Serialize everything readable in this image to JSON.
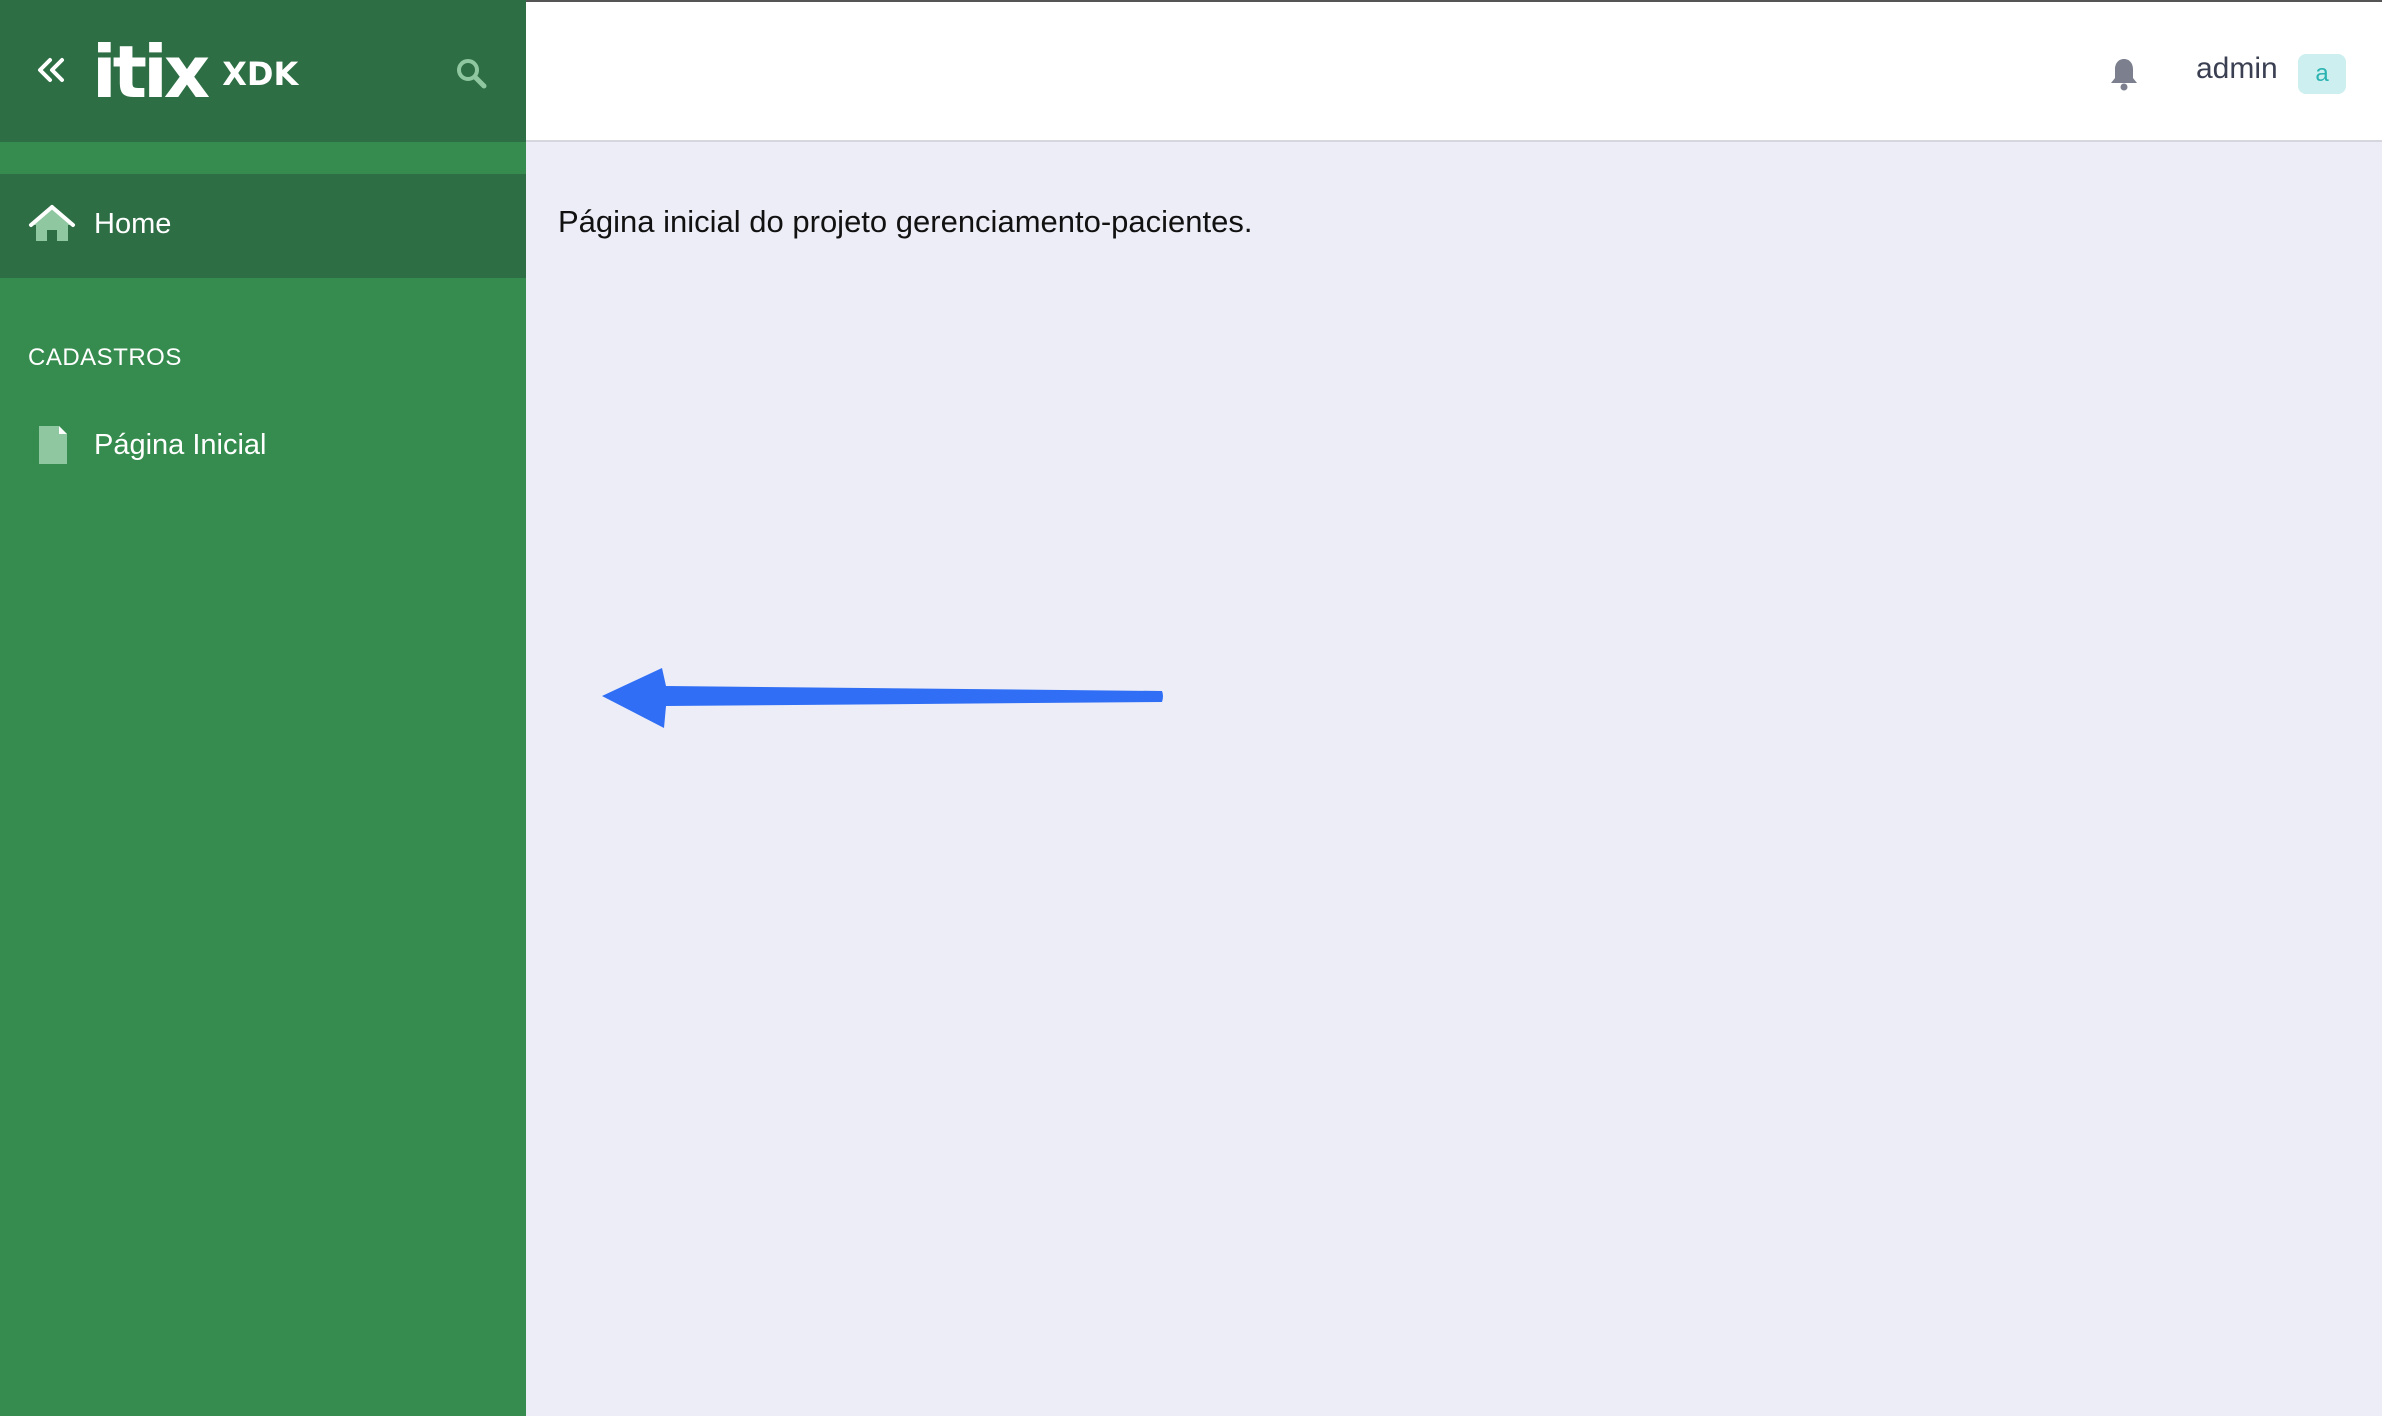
{
  "sidebar": {
    "brand": {
      "logo_text": "itix",
      "product": "XDK"
    },
    "home_label": "Home",
    "section_title": "CADASTROS",
    "items": [
      {
        "label": "Página Inicial",
        "icon": "file-icon"
      }
    ],
    "icons": {
      "collapse": "double-chevron-left-icon",
      "search": "search-icon",
      "home": "home-icon"
    }
  },
  "header": {
    "user_name": "admin",
    "avatar_initial": "a",
    "icons": {
      "notifications": "bell-icon"
    }
  },
  "main": {
    "text": "Página inicial do projeto gerenciamento-pacientes."
  },
  "colors": {
    "sidebar_bg": "#358c4e",
    "sidebar_active": "#2d6e44",
    "main_bg": "#ecedf6",
    "arrow": "#2f6ef5",
    "avatar_bg": "#cdeff0",
    "avatar_fg": "#2ab3b0"
  }
}
